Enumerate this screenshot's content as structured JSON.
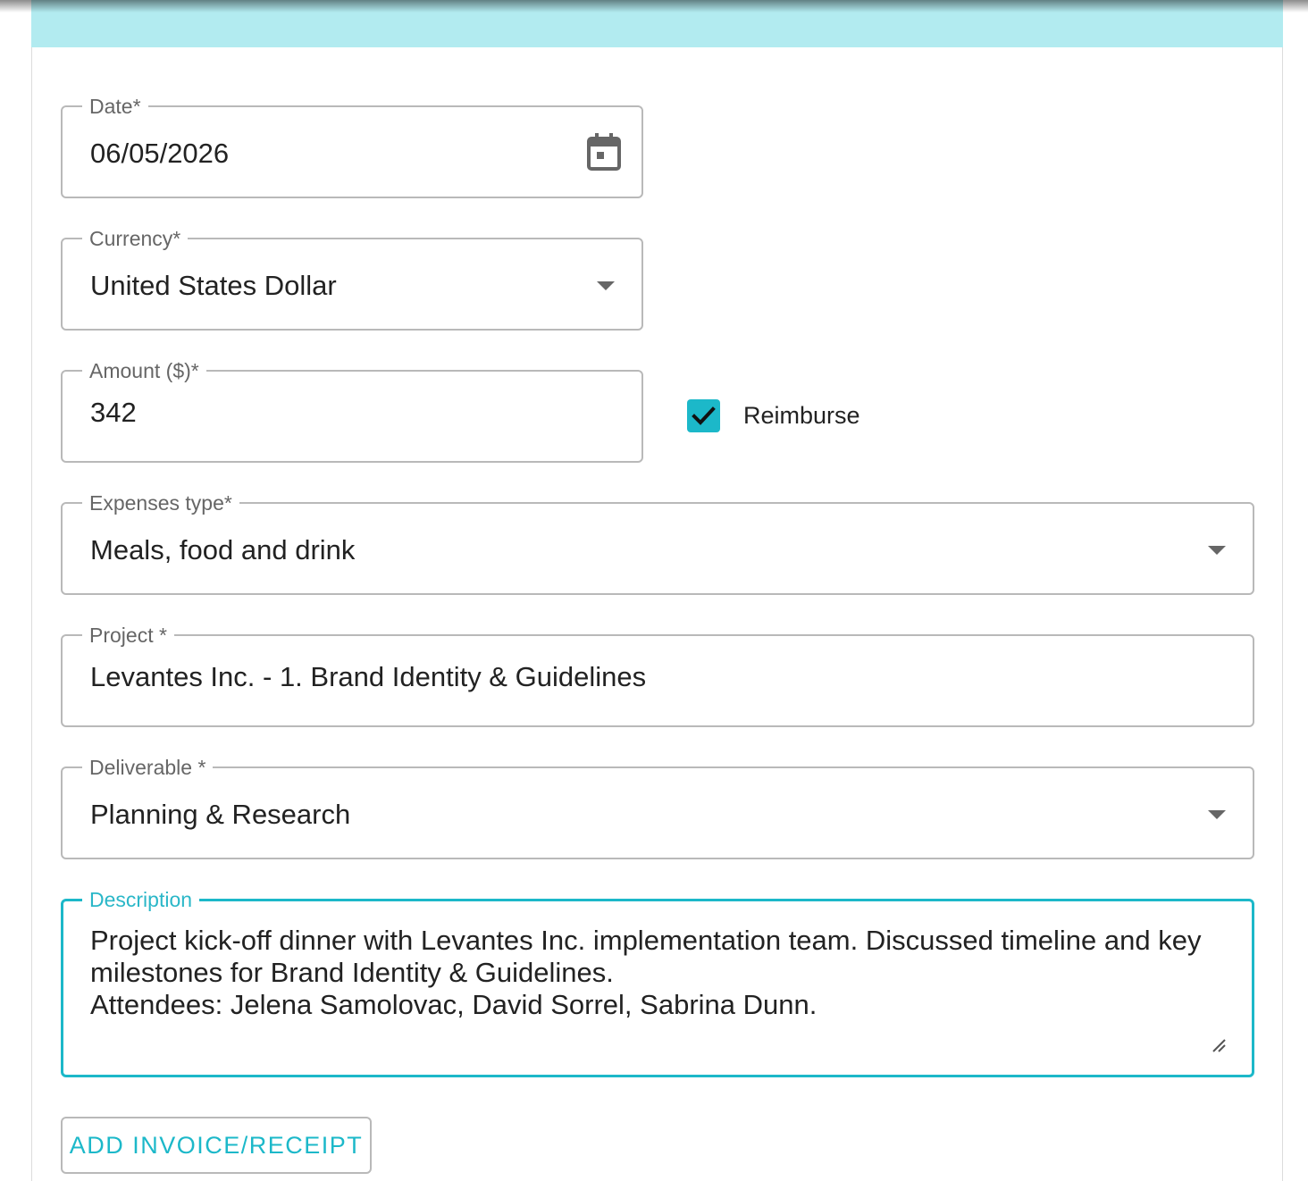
{
  "colors": {
    "accent": "#1cb8c9",
    "header_band": "#b2ebf0",
    "border": "#b9b9b9",
    "label": "#666666",
    "text": "#222222"
  },
  "form": {
    "date": {
      "label": "Date*",
      "value": "06/05/2026",
      "icon": "calendar-icon"
    },
    "currency": {
      "label": "Currency*",
      "value": "United States Dollar",
      "icon": "chevron-down-icon"
    },
    "amount": {
      "label": "Amount ($)*",
      "value": "342"
    },
    "reimburse": {
      "label": "Reimburse",
      "checked": true,
      "icon": "checkmark-icon"
    },
    "expenses_type": {
      "label": "Expenses type*",
      "value": "Meals, food and drink",
      "icon": "chevron-down-icon"
    },
    "project": {
      "label": "Project *",
      "value": "Levantes Inc. - 1. Brand Identity & Guidelines"
    },
    "deliverable": {
      "label": "Deliverable *",
      "value": "Planning & Research",
      "icon": "chevron-down-icon"
    },
    "description": {
      "label": "Description",
      "value": "Project kick-off dinner with Levantes Inc. implementation team. Discussed timeline and key milestones for Brand Identity & Guidelines.\nAttendees: Jelena Samolovac, David Sorrel, Sabrina Dunn.",
      "icon": "resize-handle-icon"
    },
    "add_invoice_label": "ADD INVOICE/RECEIPT"
  }
}
